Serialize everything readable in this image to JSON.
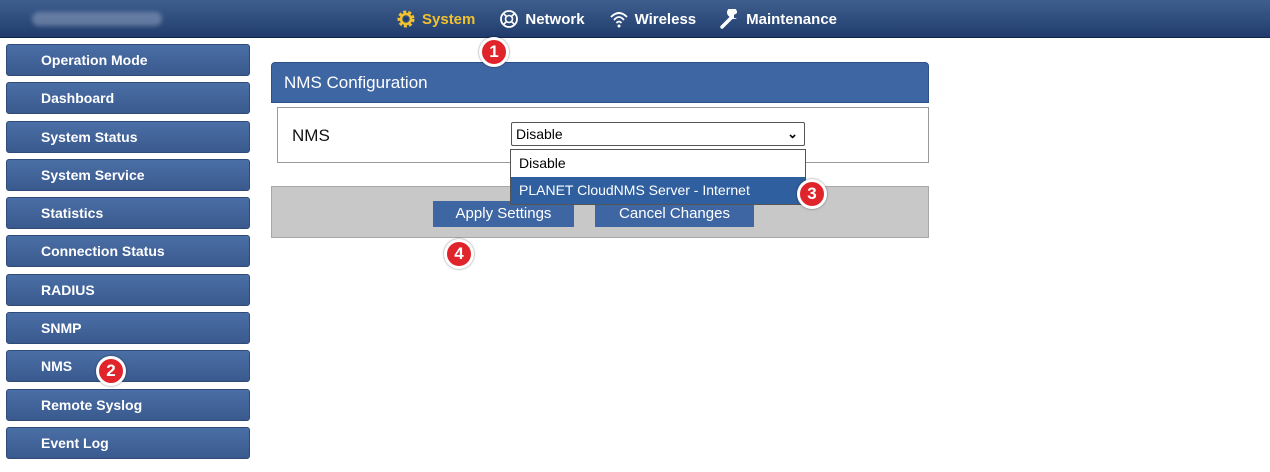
{
  "topbar": {
    "nav": [
      {
        "label": "System",
        "icon": "gear-icon",
        "active": true
      },
      {
        "label": "Network",
        "icon": "network-icon",
        "active": false
      },
      {
        "label": "Wireless",
        "icon": "wifi-icon",
        "active": false
      },
      {
        "label": "Maintenance",
        "icon": "wrench-icon",
        "active": false
      }
    ]
  },
  "sidebar": {
    "items": [
      {
        "label": "Operation Mode"
      },
      {
        "label": "Dashboard"
      },
      {
        "label": "System Status"
      },
      {
        "label": "System Service"
      },
      {
        "label": "Statistics"
      },
      {
        "label": "Connection Status"
      },
      {
        "label": "RADIUS"
      },
      {
        "label": "SNMP"
      },
      {
        "label": "NMS"
      },
      {
        "label": "Remote Syslog"
      },
      {
        "label": "Event Log"
      }
    ]
  },
  "main": {
    "title": "NMS Configuration",
    "field_label": "NMS",
    "select_value": "Disable",
    "options": [
      "Disable",
      "PLANET CloudNMS Server - Internet"
    ],
    "apply_label": "Apply Settings",
    "cancel_label": "Cancel Changes"
  },
  "markers": [
    "1",
    "2",
    "3",
    "4"
  ],
  "colors": {
    "accent": "#3e66a3",
    "active_nav": "#f2c12e",
    "marker": "#e0242b"
  }
}
